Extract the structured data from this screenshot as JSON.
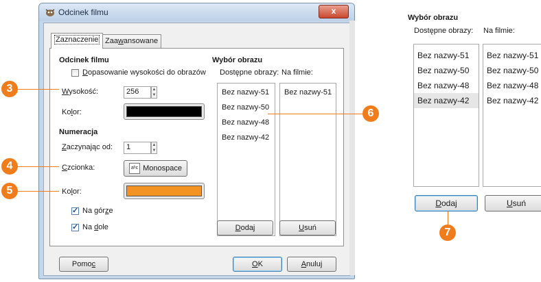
{
  "dialog": {
    "title": "Odcinek filmu",
    "close_label": "x",
    "tabs": [
      {
        "pre": "Zaznaczenie",
        "ul": "",
        "post": "",
        "active": true
      },
      {
        "pre": "Zaa",
        "ul": "w",
        "post": "ansowane",
        "active": false
      }
    ],
    "film_section": {
      "heading": "Odcinek filmu",
      "fit_height": {
        "pre": "",
        "ul": "D",
        "post": "opasowanie wysokości do obrazów",
        "checked": false
      },
      "height": {
        "pre": "",
        "ul": "W",
        "post": "ysokość:",
        "value": "256"
      },
      "color": {
        "pre": "Ko",
        "ul": "l",
        "post": "or:",
        "value": "#000000"
      }
    },
    "numbering_section": {
      "heading": "Numeracja",
      "start_at": {
        "pre": "",
        "ul": "Z",
        "post": "aczynając od:",
        "value": "1"
      },
      "font": {
        "pre": "",
        "ul": "C",
        "post": "zcionka:",
        "value": "Monospace",
        "icon_text": "aᵇc"
      },
      "color": {
        "pre": "Ko",
        "ul": "l",
        "post": "or:",
        "value": "#f39422"
      },
      "at_top": {
        "pre": "Na gór",
        "ul": "z",
        "post": "e",
        "checked": true
      },
      "at_bottom": {
        "pre": "Na ",
        "ul": "d",
        "post": "ole",
        "checked": true
      }
    },
    "image_selection": {
      "heading": "Wybór obrazu",
      "available_label": "Dostępne obrazy:",
      "on_film_label": "Na filmie:",
      "available": [
        "Bez nazwy-51",
        "Bez nazwy-50",
        "Bez nazwy-48",
        "Bez nazwy-42"
      ],
      "on_film": [
        "Bez nazwy-51"
      ],
      "add": {
        "pre": "",
        "ul": "D",
        "post": "odaj"
      },
      "remove": {
        "pre": "",
        "ul": "U",
        "post": "suń"
      }
    },
    "footer": {
      "help": {
        "pre": "Pomo",
        "ul": "c",
        "post": ""
      },
      "ok": {
        "pre": "",
        "ul": "O",
        "post": "K"
      },
      "cancel": {
        "pre": "",
        "ul": "A",
        "post": "nuluj"
      }
    }
  },
  "zoom_panel": {
    "heading": "Wybór obrazu",
    "available_label": "Dostępne obrazy:",
    "on_film_label": "Na filmie:",
    "available": [
      "Bez nazwy-51",
      "Bez nazwy-50",
      "Bez nazwy-48",
      "Bez nazwy-42"
    ],
    "selected_index": 3,
    "on_film": [
      "Bez nazwy-51",
      "Bez nazwy-50",
      "Bez nazwy-48",
      "Bez nazwy-42"
    ],
    "add": {
      "pre": "",
      "ul": "D",
      "post": "odaj"
    },
    "remove": {
      "pre": "",
      "ul": "U",
      "post": "suń"
    }
  },
  "callouts": [
    "3",
    "4",
    "5",
    "6",
    "7"
  ],
  "colors": {
    "callout": "#f07d1c",
    "accent_border": "#3c7fb1"
  }
}
